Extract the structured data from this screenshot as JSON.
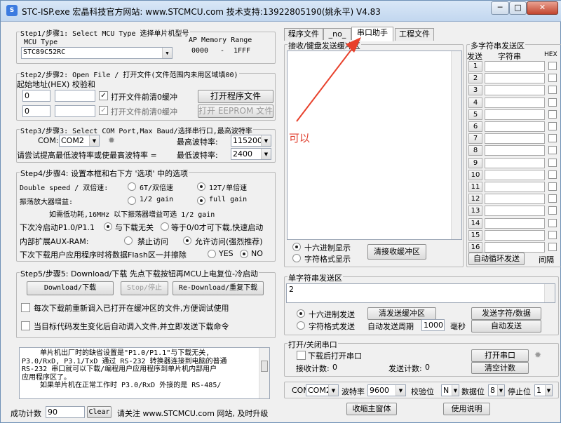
{
  "window": {
    "title": "STC-ISP.exe 宏晶科技官方网站: www.STCMCU.com 技术支持:13922805190(姚永平) V4.83",
    "minimize": "─",
    "maximize": "□",
    "close": "✕"
  },
  "step1": {
    "label": "Step1/步骤1: Select MCU Type  选择单片机型号",
    "mcu_type_label": "MCU Type",
    "mcu_value": "STC89C52RC",
    "ap_label": "AP Memory Range",
    "ap_start": "0000",
    "ap_dash": "-",
    "ap_end": "1FFF"
  },
  "step2": {
    "label": "Step2/步骤2: Open File / 打开文件(文件范围内未用区域填00)",
    "addr_label": "起始地址(HEX) 校验和",
    "addr1": "0",
    "addr2": "0",
    "chk1_label": "打开文件前清0缓冲",
    "chk2_label": "打开文件前清0缓冲",
    "open_prog_btn": "打开程序文件",
    "open_eeprom_btn": "打开 EEPROM 文件",
    "check_mark": "✓"
  },
  "step3": {
    "label": "Step3/步骤3: Select COM Port,Max Baud/选择串行口,最高波特率",
    "com_label": "COM:",
    "com_value": "COM2",
    "max_baud_label": "最高波特率:",
    "max_baud_value": "115200",
    "hint": "请尝试提高最低波特率或使最高波特率 =",
    "min_baud_label": "最低波特率:",
    "min_baud_value": "2400"
  },
  "step4": {
    "label": "Step4/步骤4: 设置本框和右下方 '选项' 中的选项",
    "double_speed_label": "Double speed / 双倍速:",
    "opt_6t": "6T/双倍速",
    "opt_12t": "12T/单倍速",
    "amp_label": "振荡放大器增益:",
    "opt_half": "1/2 gain",
    "opt_full": "full gain",
    "low_power_hint": "如需低功耗,16MHz 以下振荡器增益可选 1/2 gain",
    "cold_start_label": "下次冷启动P1.0/P1.1",
    "opt_unrelated": "与下载无关",
    "opt_equal0": "等于0/0才可下载,快速启动",
    "aux_ram_label": "内部扩展AUX-RAM:",
    "opt_disable": "禁止访问",
    "opt_allow": "允许访问(强烈推荐)",
    "erase_label": "下次下载用户应用程序时将数据Flash区一并擦除",
    "opt_yes": "YES",
    "opt_no": "NO"
  },
  "step5": {
    "label": "Step5/步骤5: Download/下载  先点下载按钮再MCU上电复位-冷启动",
    "download_btn": "Download/下载",
    "stop_btn": "Stop/停止",
    "redownload_btn": "Re-Download/重复下载",
    "chk_reload": "每次下载前重新调入已打开在缓冲区的文件,方便调试使用",
    "chk_autoload": "当目标代码发生变化后自动调入文件,并立即发送下载命令"
  },
  "info_text": [
    "单片机出厂时的缺省设置是\"P1.0/P1.1\"与下载无关,",
    "P3.0/RxD, P3.1/TxD 通过 RS-232 转换器连接到电脑的普通",
    "RS-232 串口就可以下载/编程用户应用程序到单片机内部用户",
    "应用程序区了。",
    "如果单片机在正常工作时 P3.0/RxD 外接的是 RS-485/"
  ],
  "statusbar": {
    "success_label": "成功计数",
    "success_value": "90",
    "clear_btn": "Clear",
    "notice": "请关注 www.STCMCU.com 网站, 及时升级"
  },
  "tabs": [
    {
      "label": "程序文件"
    },
    {
      "label": "_no_"
    },
    {
      "label": "串口助手"
    },
    {
      "label": "工程文件"
    }
  ],
  "serial": {
    "recv_group": "接收/键盘发送缓冲区",
    "annotation": "可以",
    "hex_display": "十六进制显示",
    "char_display": "字符格式显示",
    "clear_recv_btn": "清接收缓冲区",
    "single_group": "单字符串发送区",
    "send_value": "2",
    "hex_send": "十六进制发送",
    "char_send": "字符格式发送",
    "clear_send_btn": "清发送缓冲区",
    "auto_send_label": "自动发送周期",
    "auto_period": "1000",
    "ms_label": "毫秒",
    "send_btn": "发送字符/数据",
    "auto_send_btn": "自动发送",
    "port_group": "打开/关闭串口",
    "chk_open_after": "下载后打开串口",
    "recv_count_label": "接收计数:",
    "recv_count": "0",
    "send_count_label": "发送计数:",
    "send_count": "0",
    "open_port_btn": "打开串口",
    "clear_count_btn": "清空计数",
    "com_label": "COM",
    "com_value": "COM2",
    "baud_label": "波特率",
    "baud_value": "9600",
    "parity_label": "校验位",
    "parity_value": "N",
    "databits_label": "数据位",
    "databits_value": "8",
    "stopbits_label": "停止位",
    "stopbits_value": "1",
    "shrink_btn": "收缩主窗体",
    "help_btn": "使用说明"
  },
  "multi": {
    "group": "多字符串发送区",
    "col_send": "发送",
    "col_string": "字符串",
    "col_hex": "HEX",
    "rows": [
      "1",
      "2",
      "3",
      "4",
      "5",
      "6",
      "7",
      "8",
      "9",
      "10",
      "11",
      "12",
      "13",
      "14",
      "15",
      "16"
    ],
    "loop_btn": "自动循环发送",
    "interval_label": "间隔"
  },
  "colors": {
    "arrow": "#e8412c",
    "annotation": "#e04030"
  }
}
